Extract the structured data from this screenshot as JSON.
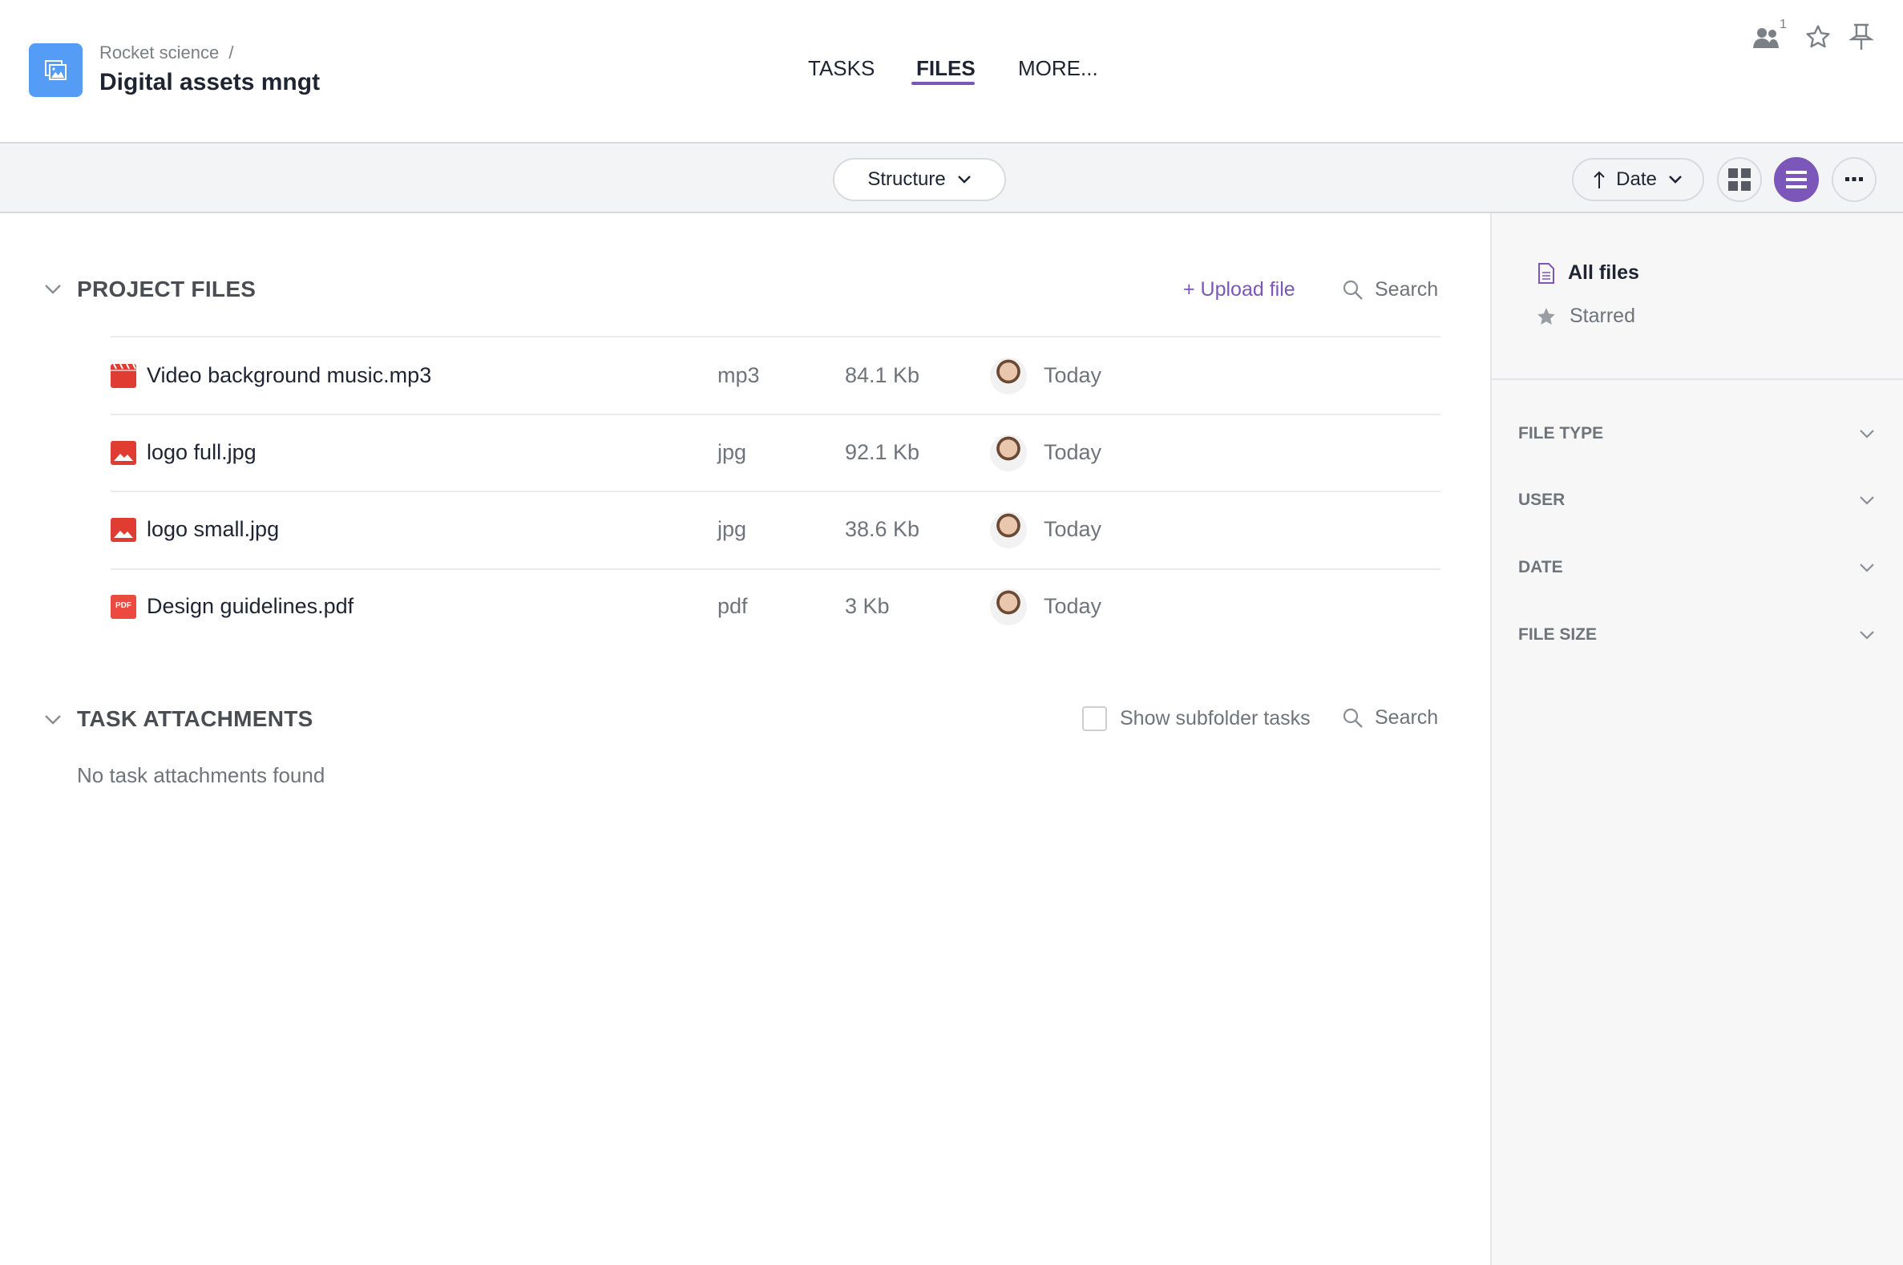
{
  "header": {
    "breadcrumb": "Rocket science",
    "breadcrumb_sep": "/",
    "title": "Digital assets mngt",
    "tabs": [
      {
        "label": "TASKS",
        "active": false
      },
      {
        "label": "FILES",
        "active": true
      },
      {
        "label": "MORE..."
      }
    ],
    "members_count": "1"
  },
  "toolbar": {
    "structure_label": "Structure",
    "sort_label": "Date",
    "accent": "#7a57b8"
  },
  "project_files": {
    "title": "PROJECT FILES",
    "upload_label": "+ Upload file",
    "search_label": "Search",
    "files": [
      {
        "name": "Video background music.mp3",
        "type": "mp3",
        "size": "84.1 Kb",
        "date": "Today",
        "icon": "video-file-icon"
      },
      {
        "name": "logo full.jpg",
        "type": "jpg",
        "size": "92.1 Kb",
        "date": "Today",
        "icon": "image-file-icon"
      },
      {
        "name": "logo small.jpg",
        "type": "jpg",
        "size": "38.6 Kb",
        "date": "Today",
        "icon": "image-file-icon"
      },
      {
        "name": "Design guidelines.pdf",
        "type": "pdf",
        "size": "3 Kb",
        "date": "Today",
        "icon": "pdf-file-icon",
        "icon_text": "PDF"
      }
    ]
  },
  "task_attachments": {
    "title": "TASK ATTACHMENTS",
    "checkbox_label": "Show subfolder tasks",
    "checked": false,
    "search_label": "Search",
    "empty": "No task attachments found"
  },
  "sidebar": {
    "all_files": "All files",
    "starred": "Starred",
    "filters": [
      "FILE TYPE",
      "USER",
      "DATE",
      "FILE SIZE"
    ]
  }
}
